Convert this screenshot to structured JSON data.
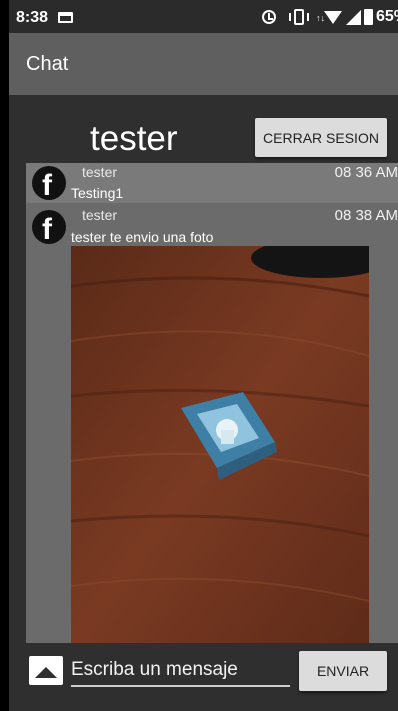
{
  "status_bar": {
    "time": "8:38",
    "battery": "65%",
    "data_indicator": "↑↓",
    "icons": [
      "card-icon",
      "alarm-icon",
      "vibrate-icon",
      "data-icon",
      "wifi-icon",
      "signal-icon",
      "battery-icon"
    ]
  },
  "app_bar": {
    "title": "Chat"
  },
  "header": {
    "username": "tester",
    "logout_label": "CERRAR SESION"
  },
  "messages": [
    {
      "user": "tester",
      "time": "08 36 AM",
      "text": "Testing1",
      "avatar_letter": "f"
    },
    {
      "user": "tester",
      "time": "08 38 AM",
      "text": "tester te envio una foto",
      "avatar_letter": "f",
      "has_photo": true
    }
  ],
  "composer": {
    "placeholder": "Escriba un mensaje",
    "send_label": "ENVIAR"
  },
  "colors": {
    "app_bar": "#5f5f5f",
    "background": "#2f2f2f",
    "panel": "#6b6b6b",
    "button": "#dcdcdc"
  }
}
